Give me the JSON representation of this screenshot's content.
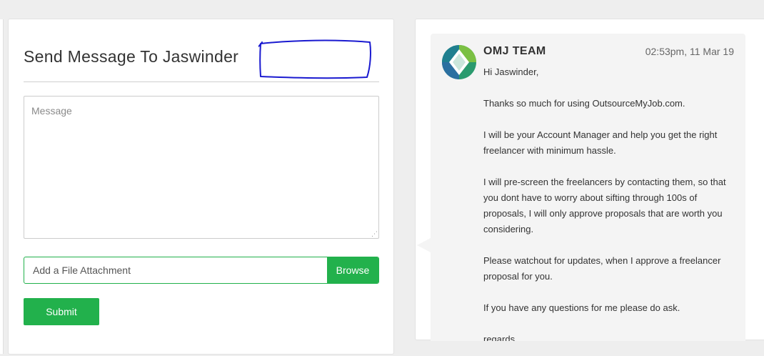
{
  "compose": {
    "title": "Send Message To Jaswinder",
    "message_placeholder": "Message",
    "attachment_placeholder": "Add a File Attachment",
    "browse_label": "Browse",
    "submit_label": "Submit",
    "annotation": "redaction-scribble"
  },
  "message": {
    "sender": "OMJ TEAM",
    "timestamp": "02:53pm, 11 Mar 19",
    "avatar_icon": "omj-logo-icon",
    "paragraphs": [
      "Hi Jaswinder,",
      "Thanks so much for using OutsourceMyJob.com.",
      "I will be your Account Manager and help you get the right freelancer with minimum hassle.",
      "I will pre-screen the freelancers by contacting them, so that you dont have to worry about sifting through 100s of proposals, I will only approve proposals that are worth you considering.",
      "Please watchout for updates, when I approve a freelancer proposal for you.",
      "If you have any questions for me please do ask.",
      "regards"
    ]
  },
  "colors": {
    "accent_green": "#22b14c",
    "bubble_bg": "#f4f4f4",
    "page_bg": "#eeeeee",
    "annotation_ink": "#1a1ad0"
  }
}
